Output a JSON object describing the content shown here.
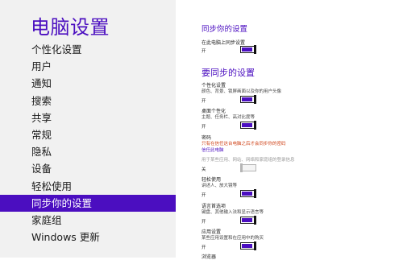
{
  "app_title": "电脑设置",
  "nav": [
    {
      "label": "个性化设置"
    },
    {
      "label": "用户"
    },
    {
      "label": "通知"
    },
    {
      "label": "搜索"
    },
    {
      "label": "共享"
    },
    {
      "label": "常规"
    },
    {
      "label": "隐私"
    },
    {
      "label": "设备"
    },
    {
      "label": "轻松使用"
    },
    {
      "label": "同步你的设置",
      "active": true
    },
    {
      "label": "家庭组"
    },
    {
      "label": "Windows 更新"
    }
  ],
  "main": {
    "section_title": "同步你的设置",
    "sync_pc": {
      "label": "在此电脑上同步设置",
      "state": "开"
    },
    "group_title": "要同步的设置",
    "items": {
      "personalize": {
        "label": "个性化设置",
        "desc": "颜色、背景、锁屏画面以及你的用户头像",
        "state": "开"
      },
      "desktop": {
        "label": "桌面个性化",
        "desc": "主题、任务栏、高对比度等",
        "state": "开"
      },
      "password": {
        "label": "密码",
        "warning": "只有在信任这台电脑之后才会同步你的密码",
        "link": "信任此电脑",
        "state": "关"
      },
      "ease": {
        "label": "轻松使用",
        "desc": "讲述人、放大镜等",
        "state": "开"
      },
      "language": {
        "label": "语言首选项",
        "desc": "键盘、其他输入法和显示语言等",
        "state": "开"
      },
      "apps": {
        "label": "应用设置",
        "desc": "某些应用设置和在应用中的购买",
        "state": "开"
      },
      "browser": {
        "label": "浏览器"
      }
    },
    "password_note": "用于某些应用、网站、网络和家庭组的登录信息"
  }
}
